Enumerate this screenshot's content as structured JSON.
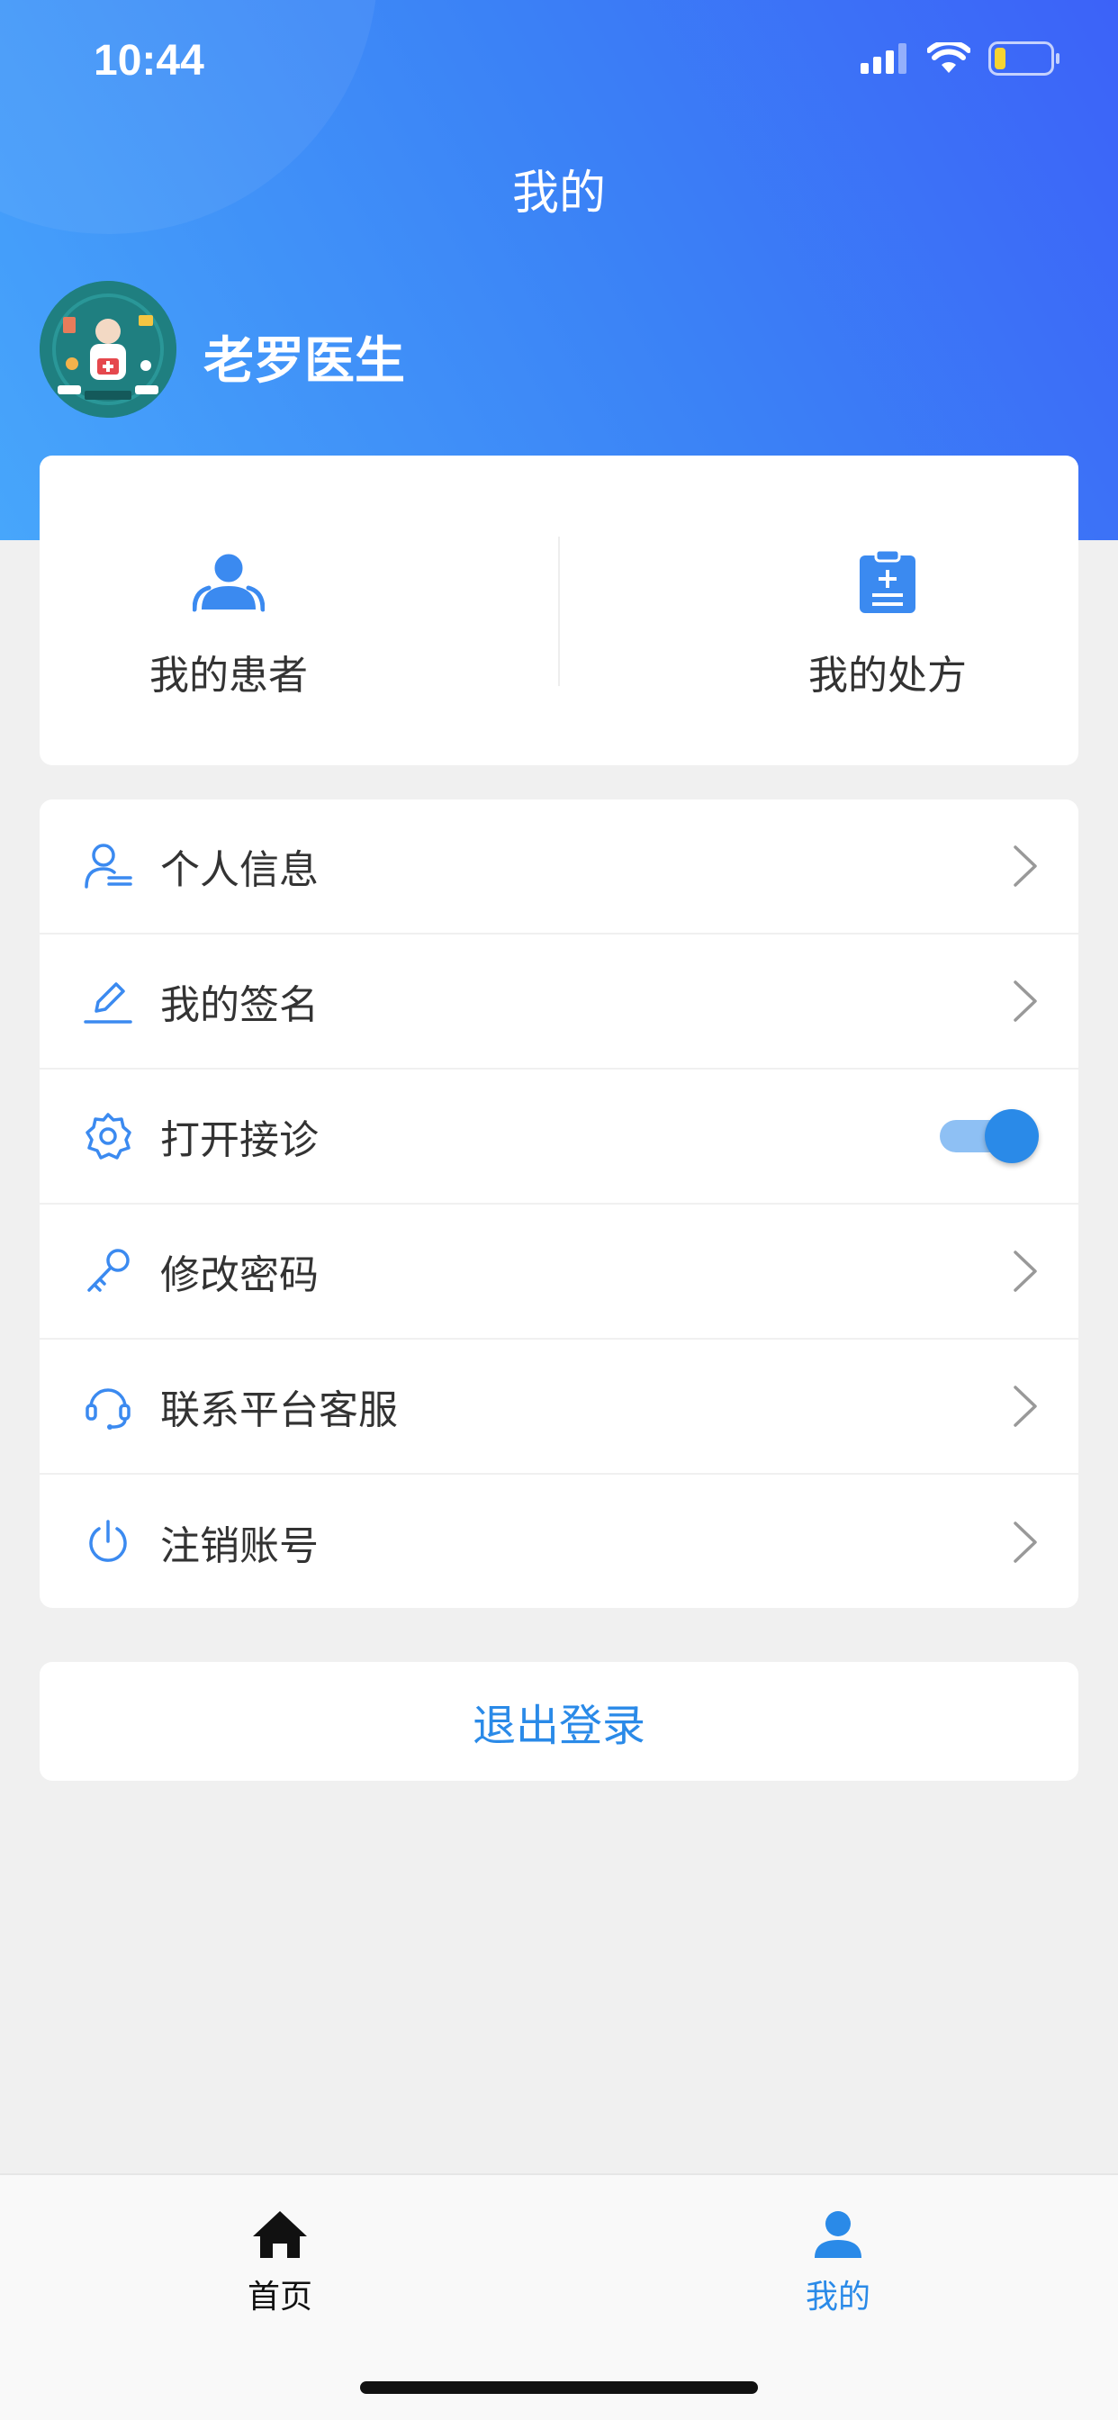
{
  "status_bar": {
    "time": "10:44",
    "icons": [
      "signal-icon",
      "wifi-icon",
      "battery-icon"
    ]
  },
  "header": {
    "title": "我的",
    "user_name": "老罗医生",
    "avatar_caption": "Doctor"
  },
  "quick_actions": [
    {
      "label": "我的患者",
      "icon": "patients-icon"
    },
    {
      "label": "我的处方",
      "icon": "prescription-icon"
    }
  ],
  "menu": [
    {
      "label": "个人信息",
      "icon": "user-info-icon",
      "control": "chevron"
    },
    {
      "label": "我的签名",
      "icon": "pen-icon",
      "control": "chevron"
    },
    {
      "label": "打开接诊",
      "icon": "gear-icon",
      "control": "toggle",
      "toggle_on": true
    },
    {
      "label": "修改密码",
      "icon": "key-icon",
      "control": "chevron"
    },
    {
      "label": "联系平台客服",
      "icon": "headset-icon",
      "control": "chevron"
    },
    {
      "label": "注销账号",
      "icon": "power-icon",
      "control": "chevron"
    }
  ],
  "logout": {
    "label": "退出登录"
  },
  "tabbar": [
    {
      "label": "首页",
      "icon": "home-icon",
      "active": false
    },
    {
      "label": "我的",
      "icon": "profile-icon",
      "active": true
    }
  ],
  "colors": {
    "accent": "#2a8ae8",
    "header_gradient_start": "#47a6fb",
    "header_gradient_end": "#3c62f8",
    "icon_blue": "#3b8af0",
    "toggle_track": "#8ec0f4",
    "background": "#f0f0f0",
    "tab_inactive": "#111111"
  }
}
